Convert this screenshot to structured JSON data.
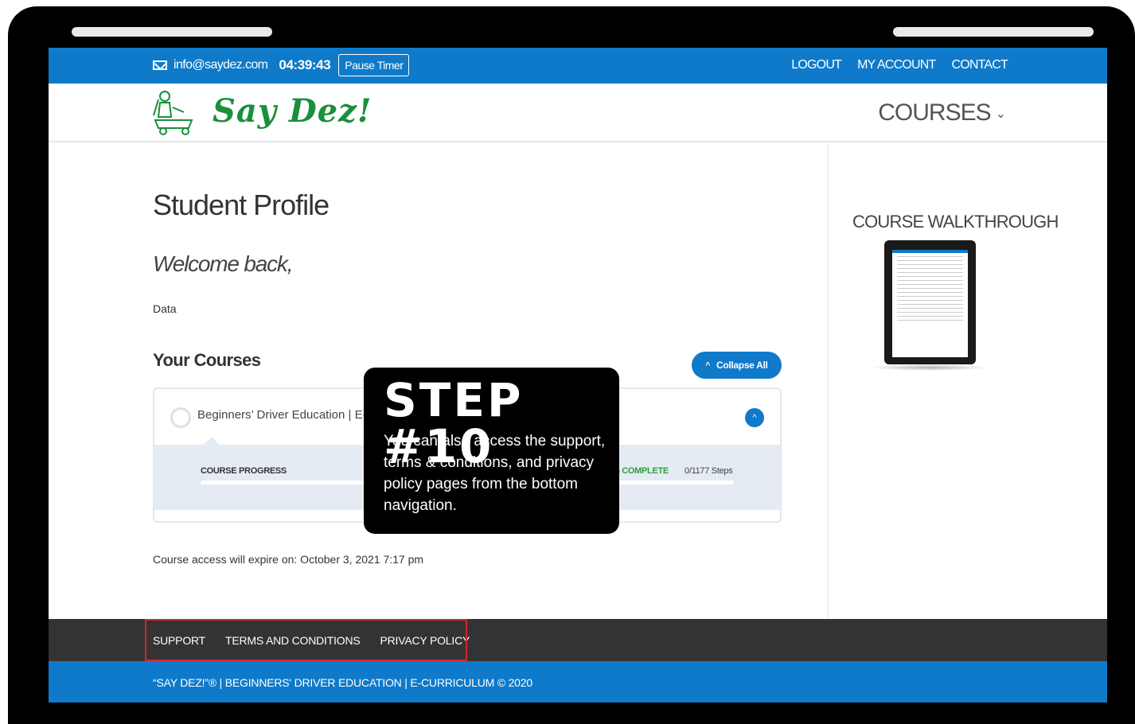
{
  "topbar": {
    "email": "info@saydez.com",
    "timer": "04:39:43",
    "pause_label": "Pause Timer",
    "links": [
      "LOGOUT",
      "MY ACCOUNT",
      "CONTACT"
    ]
  },
  "header": {
    "logo_text": "Say Dez!",
    "courses_menu": "COURSES",
    "courses_chevron": "⌄"
  },
  "main": {
    "title": "Student Profile",
    "welcome": "Welcome back,",
    "data": "Data",
    "your_courses": "Your Courses",
    "collapse_all": "Collapse All",
    "collapse_caret": "^",
    "course": {
      "name": "Beginners’ Driver Education | E-C",
      "progress_label": "COURSE PROGRESS",
      "progress_pct_text": "% COMPLETE",
      "progress_steps": "0/1177 Steps",
      "progress_value": 0,
      "expand_caret": "^"
    },
    "expire": "Course access will expire on: October 3, 2021 7:17 pm"
  },
  "sidebar": {
    "walkthrough_title": "COURSE WALKTHROUGH"
  },
  "footer": {
    "links": [
      "SUPPORT",
      "TERMS AND CONDITIONS",
      "PRIVACY POLICY"
    ],
    "copyright": "“SAY DEZ!”® | BEGINNERS' DRIVER EDUCATION | E-CURRICULUM © 2020"
  },
  "callout": {
    "title": "STEP #10",
    "text": "You can also access the support, terms & conditions, and privacy policy pages from the bottom navigation."
  },
  "colors": {
    "brand_blue": "#0f7ac9",
    "logo_green": "#1a8f3c",
    "footer_dark": "#333333",
    "highlight_red": "#d9232d",
    "complete_green": "#2e9e44"
  }
}
